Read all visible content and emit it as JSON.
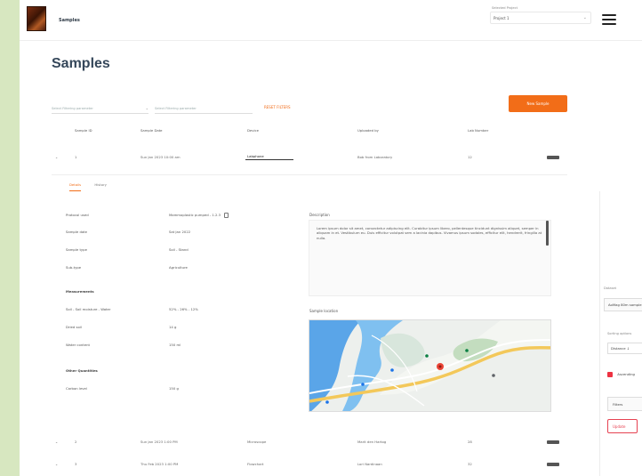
{
  "header": {
    "app_title": "Samples",
    "project_label": "Selected Project",
    "project_value": "Project 1"
  },
  "page": {
    "title": "Samples"
  },
  "filters": {
    "status_placeholder": "Select Filtering parameter",
    "value_placeholder": "Select Filtering parameter",
    "reset_label": "RESET FILTERS",
    "new_sample_button": "New Sample"
  },
  "table": {
    "headers": [
      "Sample ID",
      "Sample Date",
      "Device",
      "Uploaded by",
      "Lab Number"
    ],
    "rows": [
      {
        "id": "1",
        "date": "Sun Jan 2023 10:00 am",
        "device": "Labphone",
        "uploaded_by": "Bob from Laboratory",
        "lab_number": "12"
      },
      {
        "id": "2",
        "date": "Sun Jan 2023 1:00 PM",
        "device": "Microscope",
        "uploaded_by": "Marit den Hartog",
        "lab_number": "28"
      },
      {
        "id": "3",
        "date": "Thu Feb 2023 1:00 PM",
        "device": "Flowchart",
        "uploaded_by": "Lori Nardinaan",
        "lab_number": "32"
      }
    ]
  },
  "detail": {
    "tabs": [
      "Details",
      "History"
    ],
    "fields": [
      {
        "label": "Protocol used",
        "value": "Mammoplastic pumped - 1.2.3"
      },
      {
        "label": "Sample date",
        "value": "Sat Jan 2022"
      },
      {
        "label": "Sample type",
        "value": "Soil - Stand"
      },
      {
        "label": "Sub-type",
        "value": "Agriculture"
      }
    ],
    "measurements_title": "Measurements",
    "measurements": [
      {
        "label": "Soil - Soil moisture - Water",
        "value": "52% - 26% - 12%"
      },
      {
        "label": "Dried soil",
        "value": "14 g"
      },
      {
        "label": "Water content",
        "value": "150 ml"
      }
    ],
    "other_title": "Other Quantities",
    "other": [
      {
        "label": "Carbon level",
        "value": "150 g"
      }
    ],
    "description_title": "Description",
    "description_text": "Lorem ipsum dolor sit amet, consectetur adipiscing elit. Curabitur ipsum libero, pellentesque tincidunt dignissim aliquet, semper in aliquam in et. Vestibulum eu. Duis efficitur volutpat sem a lacinia dapibus. Vivamus ipsum sodales, efficitur elit, hendrerit, fringilla at nulla.",
    "location_title": "Sample location"
  },
  "drawer": {
    "dataset_label": "Dataset",
    "dataset_value": "AoMag 80m sample",
    "sort_label": "Sorting options",
    "sort_value": "Distance ↓",
    "ascending_label": "Ascending",
    "filters_label": "Filters",
    "update_label": "Update"
  },
  "colors": {
    "accent": "#f26d18",
    "danger": "#e64252"
  }
}
